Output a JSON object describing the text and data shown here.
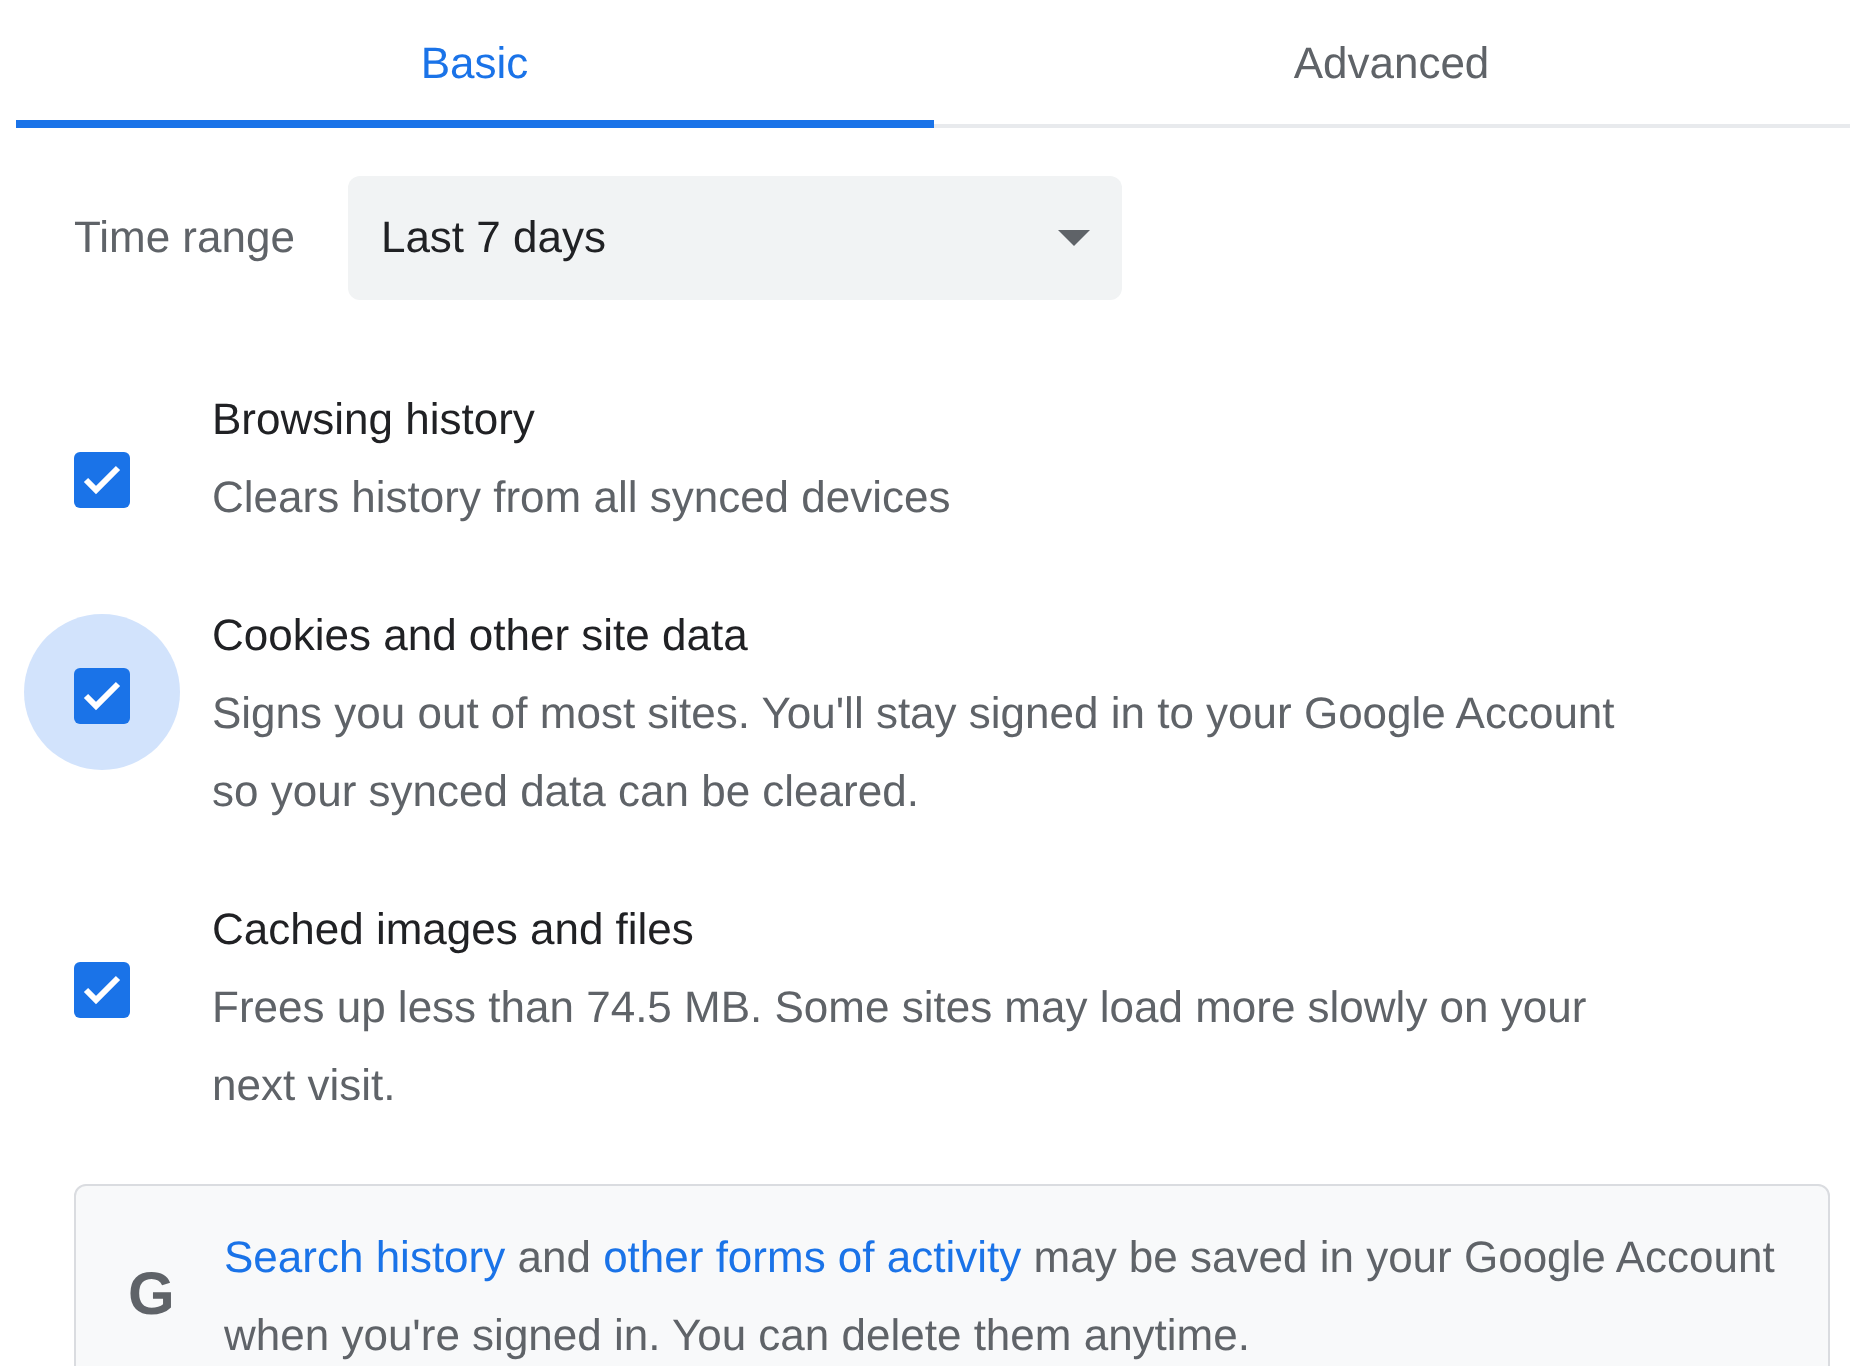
{
  "tabs": [
    {
      "label": "Basic",
      "selected": true
    },
    {
      "label": "Advanced",
      "selected": false
    }
  ],
  "time_range": {
    "label": "Time range",
    "value": "Last 7 days"
  },
  "items": [
    {
      "title": "Browsing history",
      "description": "Clears history from all synced devices",
      "checked": true,
      "focused": false
    },
    {
      "title": "Cookies and other site data",
      "description": "Signs you out of most sites. You'll stay signed in to your Google Account so your synced data can be cleared.",
      "checked": true,
      "focused": true
    },
    {
      "title": "Cached images and files",
      "description": "Frees up less than 74.5 MB. Some sites may load more slowly on your next visit.",
      "checked": true,
      "focused": false
    }
  ],
  "notice": {
    "icon": "G",
    "segments": [
      {
        "kind": "link",
        "text": "Search history"
      },
      {
        "kind": "text",
        "text": " and "
      },
      {
        "kind": "link",
        "text": "other forms of activity"
      },
      {
        "kind": "text",
        "text": " may be saved in your Google Account when you're signed in. You can delete them anytime."
      }
    ]
  }
}
